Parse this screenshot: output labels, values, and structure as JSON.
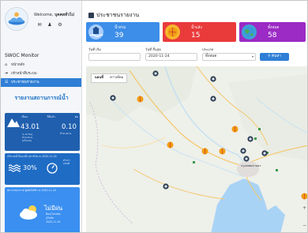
{
  "sidebar": {
    "welcome_prefix": "Welcome,",
    "welcome_user": "บุคคลทั่วไป",
    "app_title": "SWOC Monitor",
    "nav": [
      {
        "label": "หน้าหลัก",
        "icon": "home-icon",
        "active": false
      },
      {
        "label": "เข้าหน้าสืบระบบ",
        "icon": "login-icon",
        "active": false
      },
      {
        "label": "ประชาชนรายงาน",
        "icon": "report-icon",
        "active": true
      }
    ],
    "report_title": "รายงานสถานการณ์น้ำ",
    "card_water": {
      "label_1": "เขื่อน",
      "label_2": "ปีที่แล้ว",
      "label_3": "ต่อ",
      "value_1": "43.01",
      "value_2": "0.10",
      "line_1": "% ความจุ",
      "line_2": "ล้าน ลบ.ม.",
      "line_3": "(ปริมาณ)",
      "value_3": "ล้าน ลบ.ม."
    },
    "card_flow": {
      "header": "ปริมาณน้ำในแม่น้ำ สถานีวัด ณ 2020-11-24",
      "value": "30%",
      "side_1": "ต่ำกว่า",
      "side_2": "เกณฑ์"
    },
    "card_weather": {
      "header": "พยากรณ์อากาศ ผู้ผลิตไฟฟ้า ณ 2020-11-24",
      "value": "ไม่มีฝน",
      "line_1": "พิษณุโลกสมัย",
      "line_2": "สุโขทัย",
      "line_3": "2020-11-24"
    }
  },
  "main": {
    "title": "ประชาชนรายงาน",
    "stats": [
      {
        "label": "น้ำท่วม",
        "value": "39",
        "color": "#3d8ee8",
        "icon": "flood-icon"
      },
      {
        "label": "น้ำแล้ง",
        "value": "15",
        "color": "#ea3b3b",
        "icon": "drought-icon"
      },
      {
        "label": "ทั้งหมด",
        "value": "58",
        "color": "#9b2bc4",
        "icon": "globe-icon"
      }
    ],
    "filters": {
      "start_label": "วันที่ เริ่ม",
      "start_value": "",
      "end_label": "วันที่ สิ้นสุด",
      "end_value": "2020-11-24",
      "type_label": "ประเภท",
      "type_value": "ทั้งหมด",
      "search_label": "ค้นหา"
    },
    "map": {
      "tab_map": "แผนที่",
      "tab_satellite": "ดาวเทียม",
      "city_label": "กรุงเทพมหานคร"
    }
  }
}
